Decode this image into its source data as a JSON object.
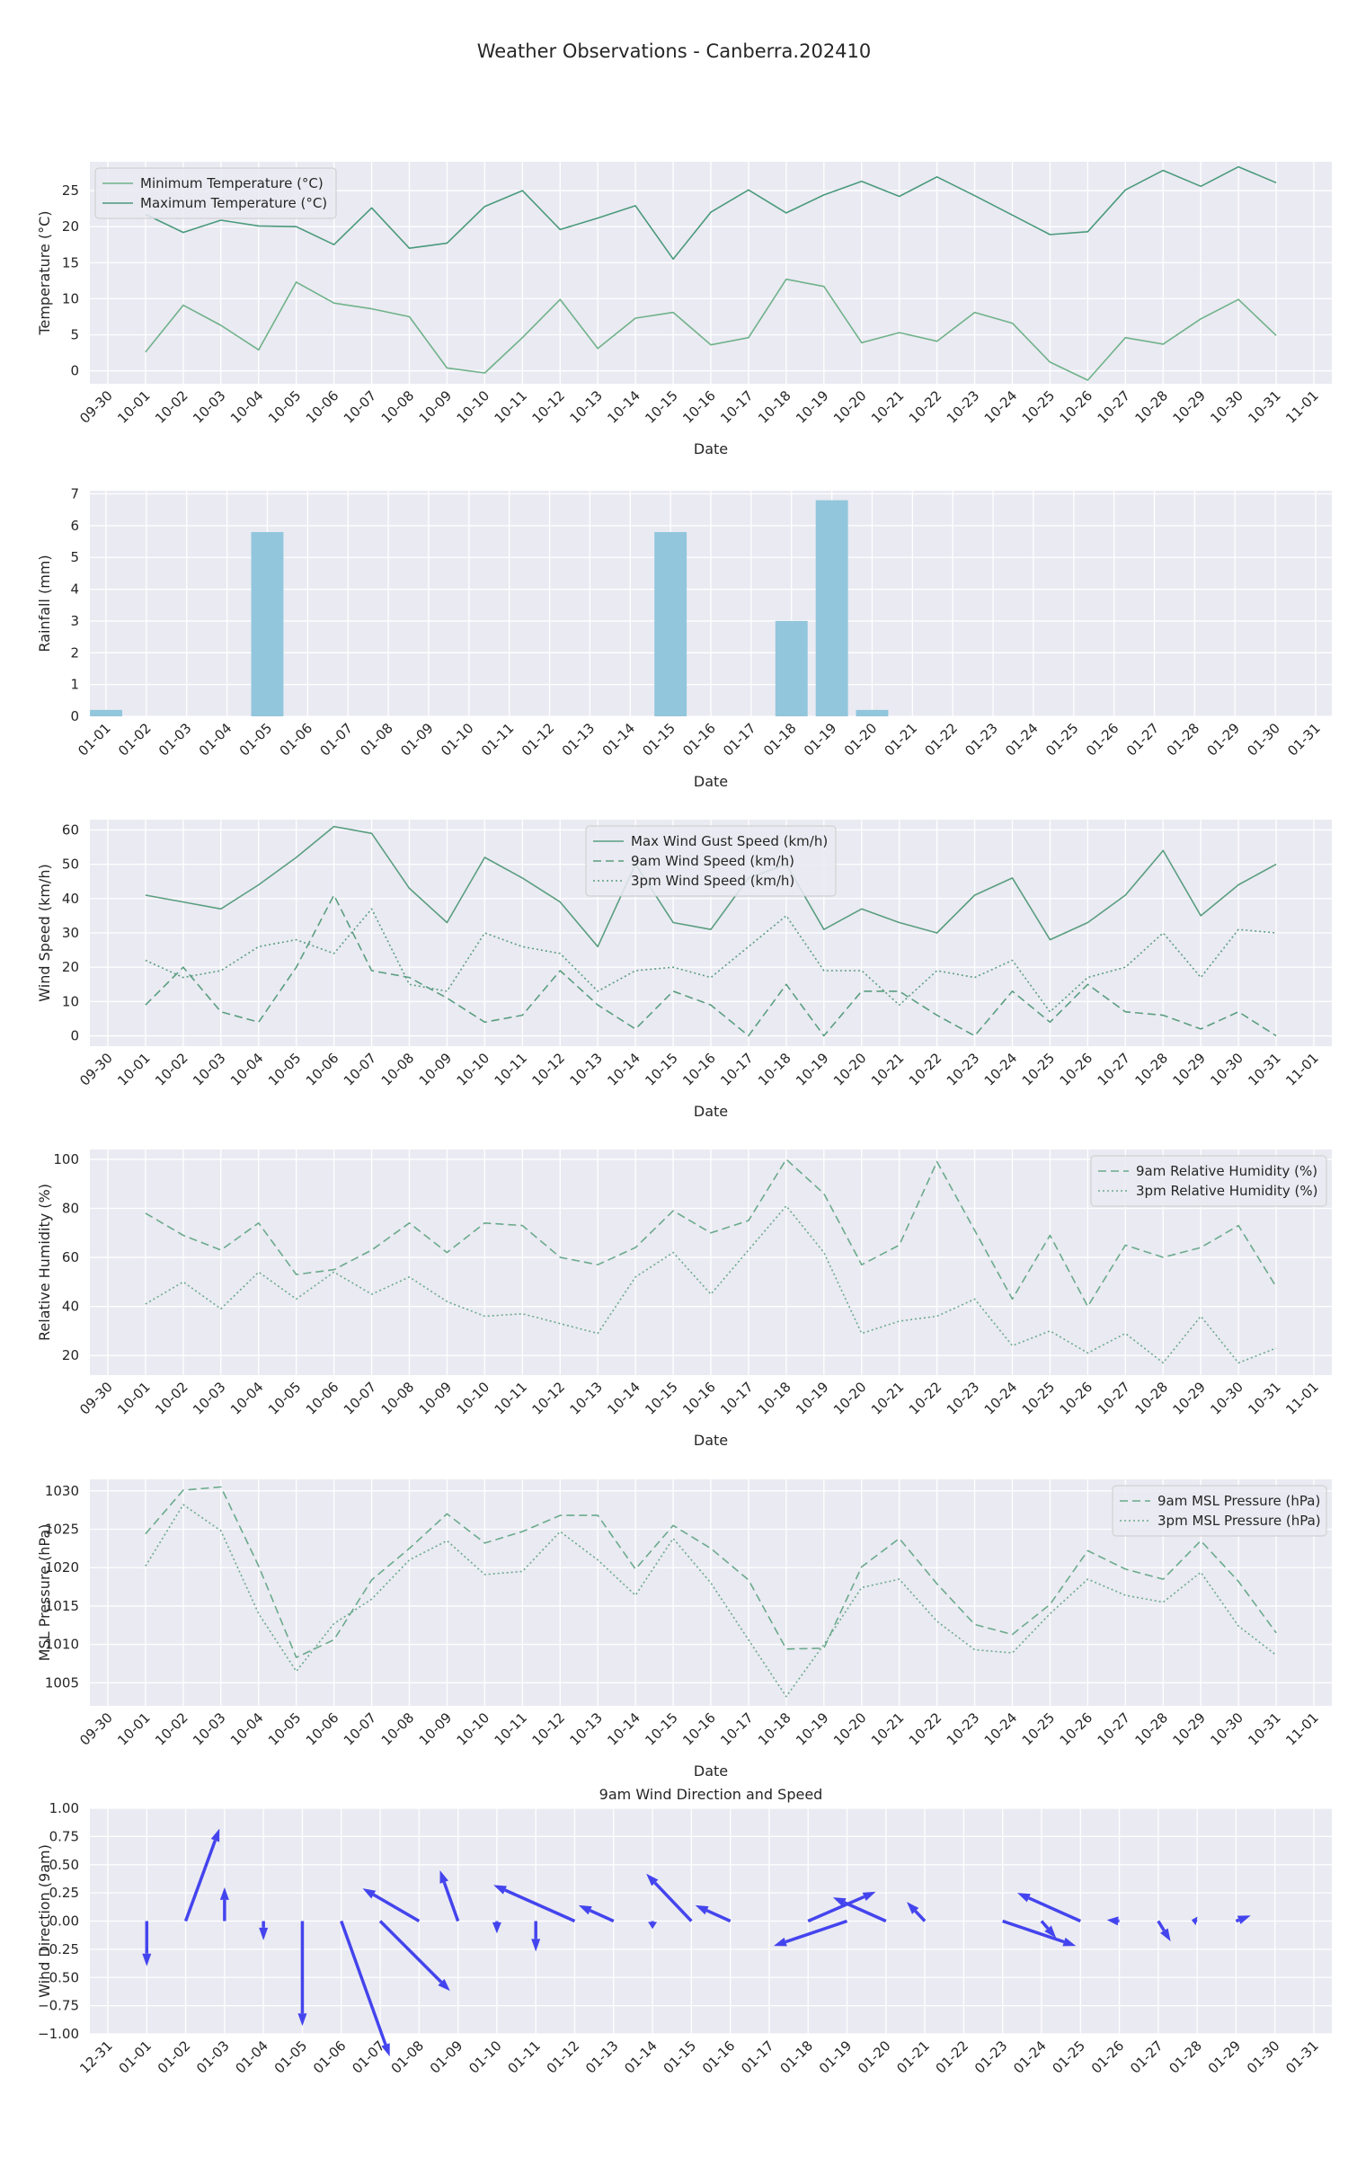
{
  "figure_title": "Weather Observations - Canberra.202410",
  "colors": {
    "plot_bg": "#eaeaf2",
    "grid": "#ffffff",
    "temp_min": "#6fb28a",
    "temp_max": "#4a9a7c",
    "rainfall": "#92c6dc",
    "wind_line": "#5a9e80",
    "humidity_line": "#6aaa8c",
    "pressure_line": "#6aaa8c",
    "quiver": "#4444ee"
  },
  "chart_data": [
    {
      "type": "line",
      "ylabel": "Temperature (°C)",
      "xlabel": "Date",
      "x_ticks": [
        "09-30",
        "10-01",
        "10-02",
        "10-03",
        "10-04",
        "10-05",
        "10-06",
        "10-07",
        "10-08",
        "10-09",
        "10-10",
        "10-11",
        "10-12",
        "10-13",
        "10-14",
        "10-15",
        "10-16",
        "10-17",
        "10-18",
        "10-19",
        "10-20",
        "10-21",
        "10-22",
        "10-23",
        "10-24",
        "10-25",
        "10-26",
        "10-27",
        "10-28",
        "10-29",
        "10-30",
        "10-31",
        "11-01"
      ],
      "y_ticks": [
        0,
        5,
        10,
        15,
        20,
        25
      ],
      "ylim": [
        -1.8,
        29
      ],
      "legend_position": "upper-left",
      "grid": true,
      "series": [
        {
          "name": "Minimum Temperature (°C)",
          "style": "solid",
          "color": "#6fb28a",
          "values": [
            2.6,
            9.1,
            6.3,
            2.9,
            12.3,
            9.4,
            8.6,
            7.5,
            0.4,
            -0.3,
            4.6,
            9.9,
            3.1,
            7.3,
            8.1,
            3.6,
            4.6,
            12.7,
            11.7,
            3.9,
            5.3,
            4.1,
            8.1,
            6.6,
            1.2,
            -1.3,
            4.6,
            3.7,
            7.2,
            9.9,
            4.9
          ]
        },
        {
          "name": "Maximum Temperature (°C)",
          "style": "solid",
          "color": "#4a9a7c",
          "values": [
            21.7,
            19.2,
            20.9,
            20.1,
            20.0,
            17.5,
            22.6,
            17.0,
            17.7,
            22.8,
            25.0,
            19.6,
            21.2,
            22.9,
            15.5,
            22.0,
            25.1,
            21.9,
            24.4,
            26.3,
            24.2,
            26.9,
            24.3,
            21.6,
            18.9,
            19.3,
            25.1,
            27.8,
            25.6,
            28.3,
            26.1
          ]
        }
      ]
    },
    {
      "type": "bar",
      "ylabel": "Rainfall (mm)",
      "xlabel": "Date",
      "x_ticks": [
        "01-01",
        "01-02",
        "01-03",
        "01-04",
        "01-05",
        "01-06",
        "01-07",
        "01-08",
        "01-09",
        "01-10",
        "01-11",
        "01-12",
        "01-13",
        "01-14",
        "01-15",
        "01-16",
        "01-17",
        "01-18",
        "01-19",
        "01-20",
        "01-21",
        "01-22",
        "01-23",
        "01-24",
        "01-25",
        "01-26",
        "01-27",
        "01-28",
        "01-29",
        "01-30",
        "01-31"
      ],
      "y_ticks": [
        0,
        1,
        2,
        3,
        4,
        5,
        6,
        7
      ],
      "ylim": [
        0,
        7.1
      ],
      "grid": true,
      "values": [
        0.2,
        0,
        0,
        0,
        5.8,
        0,
        0,
        0,
        0,
        0,
        0,
        0,
        0,
        0,
        5.8,
        0,
        0,
        3.0,
        6.8,
        0.2,
        0,
        0,
        0,
        0,
        0,
        0,
        0,
        0,
        0,
        0
      ]
    },
    {
      "type": "line",
      "ylabel": "Wind Speed (km/h)",
      "xlabel": "Date",
      "x_ticks": [
        "09-30",
        "10-01",
        "10-02",
        "10-03",
        "10-04",
        "10-05",
        "10-06",
        "10-07",
        "10-08",
        "10-09",
        "10-10",
        "10-11",
        "10-12",
        "10-13",
        "10-14",
        "10-15",
        "10-16",
        "10-17",
        "10-18",
        "10-19",
        "10-20",
        "10-21",
        "10-22",
        "10-23",
        "10-24",
        "10-25",
        "10-26",
        "10-27",
        "10-28",
        "10-29",
        "10-30",
        "10-31",
        "11-01"
      ],
      "y_ticks": [
        0,
        10,
        20,
        30,
        40,
        50,
        60
      ],
      "ylim": [
        -3,
        63
      ],
      "legend_position": "upper-center",
      "grid": true,
      "series": [
        {
          "name": "Max Wind Gust Speed (km/h)",
          "style": "solid",
          "color": "#5a9e80",
          "values": [
            41,
            39,
            37,
            44,
            52,
            61,
            59,
            43,
            33,
            52,
            46,
            39,
            26,
            50,
            33,
            31,
            46,
            50,
            31,
            37,
            33,
            30,
            41,
            46,
            28,
            33,
            41,
            54,
            35,
            44,
            50
          ]
        },
        {
          "name": "9am Wind Speed (km/h)",
          "style": "dashed",
          "color": "#5a9e80",
          "values": [
            9,
            20,
            7,
            4,
            20,
            41,
            19,
            17,
            11,
            4,
            6,
            19,
            9,
            2,
            13,
            9,
            0,
            15,
            0,
            13,
            13,
            6,
            0,
            13,
            4,
            15,
            7,
            6,
            2,
            7,
            0
          ]
        },
        {
          "name": "3pm Wind Speed (km/h)",
          "style": "dotted",
          "color": "#5a9e80",
          "values": [
            22,
            17,
            19,
            26,
            28,
            24,
            37,
            15,
            13,
            30,
            26,
            24,
            13,
            19,
            20,
            17,
            26,
            35,
            19,
            19,
            9,
            19,
            17,
            22,
            7,
            17,
            20,
            30,
            17,
            31,
            30
          ]
        }
      ]
    },
    {
      "type": "line",
      "ylabel": "Relative Humidity (%)",
      "xlabel": "Date",
      "x_ticks": [
        "09-30",
        "10-01",
        "10-02",
        "10-03",
        "10-04",
        "10-05",
        "10-06",
        "10-07",
        "10-08",
        "10-09",
        "10-10",
        "10-11",
        "10-12",
        "10-13",
        "10-14",
        "10-15",
        "10-16",
        "10-17",
        "10-18",
        "10-19",
        "10-20",
        "10-21",
        "10-22",
        "10-23",
        "10-24",
        "10-25",
        "10-26",
        "10-27",
        "10-28",
        "10-29",
        "10-30",
        "10-31",
        "11-01"
      ],
      "y_ticks": [
        20,
        40,
        60,
        80,
        100
      ],
      "ylim": [
        12,
        104
      ],
      "legend_position": "upper-right",
      "grid": true,
      "series": [
        {
          "name": "9am Relative Humidity (%)",
          "style": "dashed",
          "color": "#6aaa8c",
          "values": [
            78,
            69,
            63,
            74,
            53,
            55,
            63,
            74,
            62,
            74,
            73,
            60,
            57,
            64,
            79,
            70,
            75,
            100,
            86,
            57,
            65,
            99,
            71,
            43,
            69,
            40,
            65,
            60,
            64,
            73,
            48
          ]
        },
        {
          "name": "3pm Relative Humidity (%)",
          "style": "dotted",
          "color": "#6aaa8c",
          "values": [
            41,
            50,
            39,
            54,
            43,
            54,
            45,
            52,
            42,
            36,
            37,
            33,
            29,
            52,
            62,
            45,
            63,
            81,
            62,
            29,
            34,
            36,
            43,
            24,
            30,
            21,
            29,
            17,
            36,
            17,
            23
          ]
        }
      ]
    },
    {
      "type": "line",
      "ylabel": "MSL Pressure (hPa)",
      "xlabel": "Date",
      "x_ticks": [
        "09-30",
        "10-01",
        "10-02",
        "10-03",
        "10-04",
        "10-05",
        "10-06",
        "10-07",
        "10-08",
        "10-09",
        "10-10",
        "10-11",
        "10-12",
        "10-13",
        "10-14",
        "10-15",
        "10-16",
        "10-17",
        "10-18",
        "10-19",
        "10-20",
        "10-21",
        "10-22",
        "10-23",
        "10-24",
        "10-25",
        "10-26",
        "10-27",
        "10-28",
        "10-29",
        "10-30",
        "10-31",
        "11-01"
      ],
      "y_ticks": [
        1005,
        1010,
        1015,
        1020,
        1025,
        1030
      ],
      "ylim": [
        1002,
        1031.5
      ],
      "legend_position": "upper-right",
      "grid": true,
      "series": [
        {
          "name": "9am MSL Pressure (hPa)",
          "style": "dashed",
          "color": "#6aaa8c",
          "values": [
            1024.4,
            1030.1,
            1030.5,
            1020.2,
            1008.3,
            1010.6,
            1018.4,
            1022.5,
            1027.0,
            1023.2,
            1024.7,
            1026.8,
            1026.8,
            1019.8,
            1025.5,
            1022.5,
            1018.4,
            1009.4,
            1009.5,
            1020.1,
            1023.8,
            1017.9,
            1012.6,
            1011.3,
            1015.2,
            1022.2,
            1019.8,
            1018.5,
            1023.5,
            1018.2,
            1011.5
          ]
        },
        {
          "name": "3pm MSL Pressure (hPa)",
          "style": "dotted",
          "color": "#6aaa8c",
          "values": [
            1020.2,
            1028.2,
            1024.8,
            1014.0,
            1006.5,
            1012.7,
            1015.9,
            1021.0,
            1023.5,
            1019.1,
            1019.5,
            1024.7,
            1021.0,
            1016.4,
            1023.8,
            1018.0,
            1010.6,
            1003.2,
            1010.0,
            1017.4,
            1018.5,
            1013.0,
            1009.3,
            1008.9,
            1014.0,
            1018.5,
            1016.4,
            1015.5,
            1019.4,
            1012.4,
            1008.6
          ]
        }
      ]
    },
    {
      "type": "quiver",
      "title": "9am Wind Direction and Speed",
      "ylabel": "Wind Direction (9am)",
      "x_ticks": [
        "12-31",
        "01-01",
        "01-02",
        "01-03",
        "01-04",
        "01-05",
        "01-06",
        "01-07",
        "01-08",
        "01-09",
        "01-10",
        "01-11",
        "01-12",
        "01-13",
        "01-14",
        "01-15",
        "01-16",
        "01-17",
        "01-18",
        "01-19",
        "01-20",
        "01-21",
        "01-22",
        "01-23",
        "01-24",
        "01-25",
        "01-26",
        "01-27",
        "01-28",
        "01-29",
        "01-30",
        "01-31"
      ],
      "y_ticks": [
        "1.00",
        "0.75",
        "0.50",
        "0.25",
        "0.00",
        "−0.25",
        "−0.50",
        "−0.75",
        "−1.00"
      ],
      "ylim": [
        -1,
        1
      ],
      "grid": true,
      "vectors": [
        {
          "u": 0,
          "v": -0.4
        },
        {
          "u": 0.3,
          "v": 0.82
        },
        {
          "u": 0,
          "v": 0.3
        },
        {
          "u": 0,
          "v": -0.17
        },
        {
          "u": 0,
          "v": -0.93
        },
        {
          "u": 0.43,
          "v": -1.2
        },
        {
          "u": 0.62,
          "v": -0.62
        },
        {
          "u": -0.5,
          "v": 0.29
        },
        {
          "u": -0.16,
          "v": 0.45
        },
        {
          "u": 0,
          "v": -0.11
        },
        {
          "u": 0,
          "v": -0.27
        },
        {
          "u": -0.72,
          "v": 0.32
        },
        {
          "u": -0.31,
          "v": 0.14
        },
        {
          "u": 0,
          "v": -0.07
        },
        {
          "u": -0.4,
          "v": 0.42
        },
        {
          "u": -0.31,
          "v": 0.14
        },
        {
          "u": 0,
          "v": 0
        },
        {
          "u": 0.6,
          "v": 0.26
        },
        {
          "u": -0.65,
          "v": -0.22
        },
        {
          "u": -0.47,
          "v": 0.21
        },
        {
          "u": -0.16,
          "v": 0.17
        },
        {
          "u": 0,
          "v": 0
        },
        {
          "u": 0.65,
          "v": -0.22
        },
        {
          "u": 0.13,
          "v": -0.15
        },
        {
          "u": -0.56,
          "v": 0.25
        },
        {
          "u": -0.11,
          "v": 0.01
        },
        {
          "u": 0.11,
          "v": -0.18
        },
        {
          "u": -0.05,
          "v": 0.01
        },
        {
          "u": 0.13,
          "v": 0.05
        }
      ]
    }
  ]
}
